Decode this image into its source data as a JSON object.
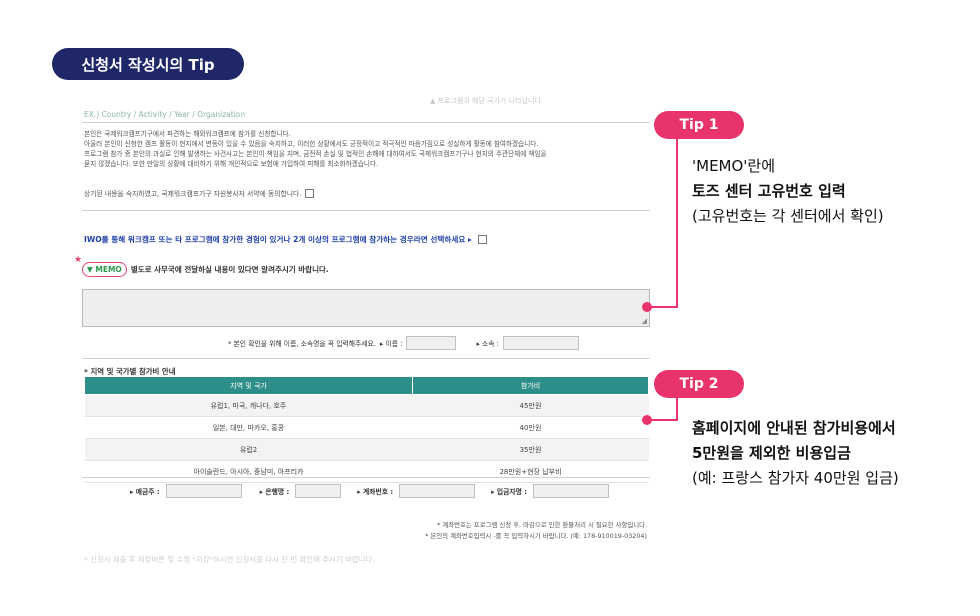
{
  "title": "신청서 작성시의 Tip",
  "form": {
    "faded_top": "▲ 프로그램과 해당 국가가 나타납니다",
    "ex_line": "EX.) Country / Activity / Year / Organization",
    "paragraph": [
      "본인은 국제워크캠프기구에서 파견하는 해외워크캠프에 참가를 신청합니다.",
      "아울러 본인이 신청한 캠프 활동이 현지에서 변동이 있을 수 있음을 숙지하고, 이러한 상황에서도 긍정적이고 적극적인 마음가짐으로 성실하게 활동에 참여하겠습니다.",
      "프로그램 참가 중 본인의 과실로 인해 발생하는 사건사고는 본인이 책임을 지며, 금전적 손실 및 법적인 손해에 대하여서도 국제워크캠프기구나 현지의 주관단체에 책임을",
      "묻지 않겠습니다. 또한 만일의 상황에 대비하기 위해 개인적으로 보험에 가입하여 피해를 최소화하겠습니다."
    ],
    "agree_text": "상기된 내용을 숙지하였고, 국제워크캠프기구 자원봉사자 서약에 동의합니다.",
    "iwo_text": "IWO를 통해 워크캠프 또는 타 프로그램에 참가한 경험이 있거나 2개 이상의 프로그램에 참가하는 경우라면 선택하세요 ▸",
    "memo_tag": "▼ MEMO",
    "memo_label": "별도로 사무국에 전달하실 내용이 있다면 알려주시기 바랍니다.",
    "name_hint": "* 본인 확인을 위해 이름, 소속명을 꼭 입력해주세요.",
    "name_label": "▸ 이름 :",
    "org_label": "▸ 소속 :",
    "section_title": "* 지역 및 국가별 참가비 안내",
    "table": {
      "headers": [
        "지역 및 국가",
        "참가비"
      ],
      "rows": [
        [
          "유럽1, 미국, 캐나다, 호주",
          "45만원"
        ],
        [
          "일본, 대만, 마카오, 홍콩",
          "40만원"
        ],
        [
          "유럽2",
          "35만원"
        ],
        [
          "아이슬란드, 아시아, 중남미, 아프리카",
          "28만원+현장 납부비"
        ]
      ]
    },
    "pay": {
      "depositor": "▸ 예금주 :",
      "bank": "▸ 은행명 :",
      "account": "▸ 계좌번호 :",
      "amount": "▸ 입금자명 :"
    },
    "notes": [
      "* 계좌번호는 프로그램 신청 후, 마감으로 인한 환불처리 시 필요한 사항입니다.",
      "* 본인의 계좌번호입력시 -를 꼭 입력하시기 바랍니다. (예: 178-910019-03204)"
    ],
    "bottom_faded": "* 신청서 제출 후 저장버튼 및 수정 \"저장\"하시면 신청서를 다시 한 번 확인해 주시기 바랍니다."
  },
  "tips": [
    {
      "label": "Tip 1",
      "lines": [
        "'MEMO'란에",
        "토즈 센터 고유번호 입력",
        "(고유번호는 각 센터에서 확인)"
      ]
    },
    {
      "label": "Tip 2",
      "lines": [
        "홈페이지에 안내된 참가비용에서",
        "5만원을 제외한 비용입금",
        "(예: 프랑스 참가자 40만원 입금)"
      ]
    }
  ],
  "colors": {
    "navy": "#1f2768",
    "pink": "#e8336c",
    "teal": "#2e8f8a",
    "blue": "#1f3fa8",
    "green": "#2a9a4a"
  }
}
